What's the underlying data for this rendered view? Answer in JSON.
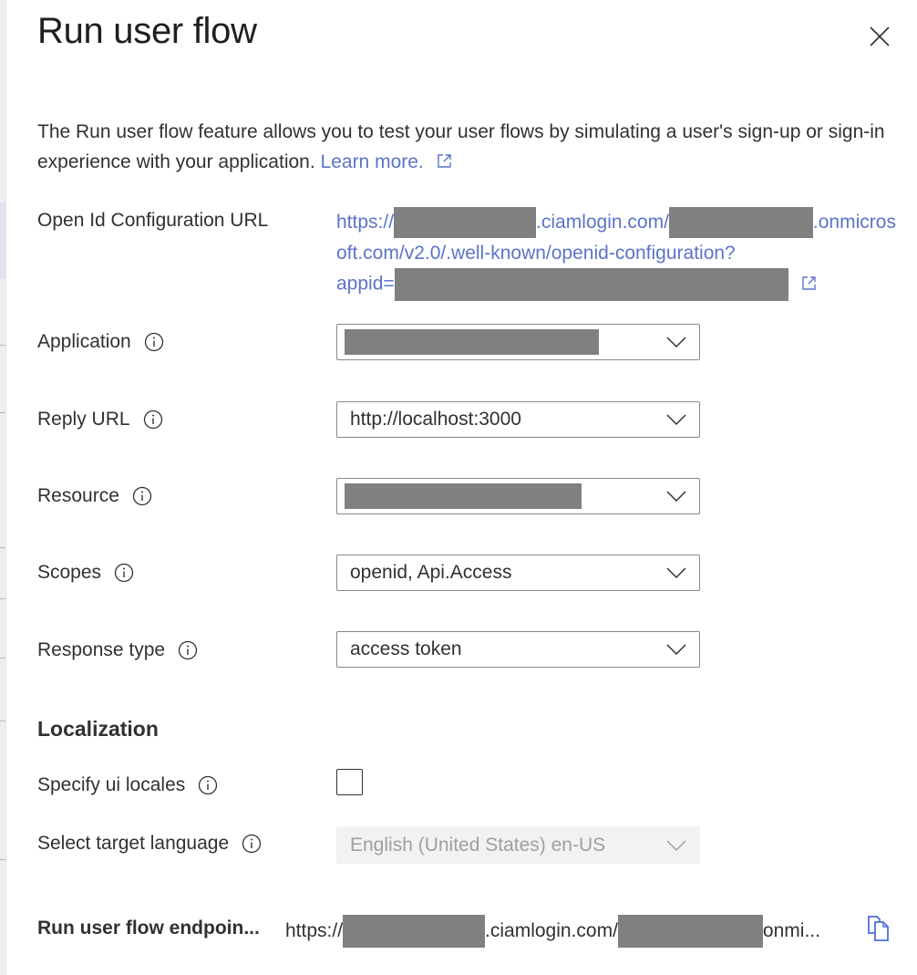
{
  "panel": {
    "title": "Run user flow",
    "close_label": "Close"
  },
  "description": {
    "text": "The Run user flow feature allows you to test your user flows by simulating a user's sign-up or sign-in experience with your application.",
    "learn_more": "Learn more."
  },
  "openid": {
    "label": "Open Id Configuration URL",
    "part1": "https://",
    "part2": ".ciamlogin.com/",
    "part3": ".onmicrosoft.com/v2.0/.well-known/openid-configuration?",
    "part4": "appid="
  },
  "fields": {
    "application": {
      "label": "Application",
      "value": ""
    },
    "reply_url": {
      "label": "Reply URL",
      "value": "http://localhost:3000"
    },
    "resource": {
      "label": "Resource",
      "value": ""
    },
    "scopes": {
      "label": "Scopes",
      "value": "openid, Api.Access"
    },
    "response_type": {
      "label": "Response type",
      "value": "access token"
    }
  },
  "localization": {
    "heading": "Localization",
    "specify_ui_locales": {
      "label": "Specify ui locales",
      "checked": false
    },
    "target_language": {
      "label": "Select target language",
      "value": "English (United States) en-US",
      "disabled": true
    }
  },
  "endpoint": {
    "label": "Run user flow endpoin...",
    "part1": "https://",
    "part2": ".ciamlogin.com/",
    "part3": "onmi..."
  },
  "colors": {
    "link": "#5b74c8",
    "text": "#323130",
    "redaction": "#808080",
    "disabled_bg": "#f3f2f1"
  }
}
